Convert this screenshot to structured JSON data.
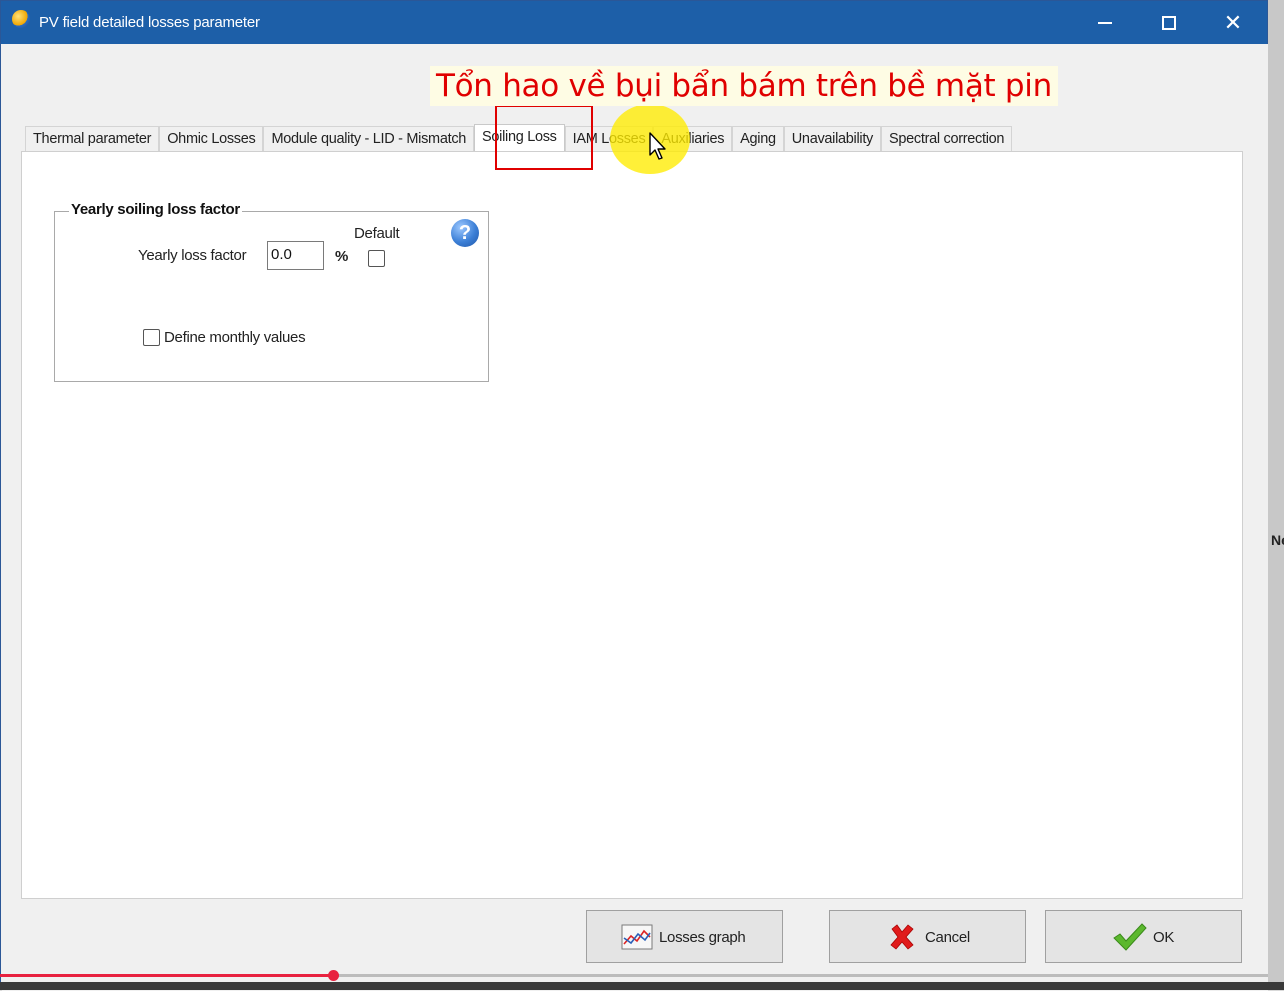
{
  "window": {
    "title": "PV field detailed losses parameter",
    "app_icon": "pvsyst-sun-icon",
    "controls": {
      "minimize": "minimize-icon",
      "maximize": "maximize-icon",
      "close_glyph": "✕"
    }
  },
  "annotation": {
    "text": "Tổn hao về bụi bẩn bám trên bề mặt pin",
    "color": "#e00000"
  },
  "tabs": [
    {
      "label": "Thermal parameter"
    },
    {
      "label": "Ohmic Losses"
    },
    {
      "label": "Module quality - LID - Mismatch"
    },
    {
      "label": "Soiling Loss",
      "active": true
    },
    {
      "label": "IAM Losses"
    },
    {
      "label": "Auxiliaries"
    },
    {
      "label": "Aging"
    },
    {
      "label": "Unavailability"
    },
    {
      "label": "Spectral correction"
    }
  ],
  "soiling": {
    "group_title": "Yearly soiling loss factor",
    "yearly_label": "Yearly loss factor",
    "yearly_value": "0.0",
    "unit": "%",
    "default_label": "Default",
    "default_checked": false,
    "monthly_label": "Define monthly values",
    "monthly_checked": false,
    "help_glyph": "?"
  },
  "buttons": {
    "losses_graph": "Losses graph",
    "cancel": "Cancel",
    "ok": "OK"
  },
  "video_progress": {
    "fraction": 0.263,
    "color": "#e8213f"
  },
  "background_edge_text": "Ne",
  "colors": {
    "titlebar": "#1d5fa8",
    "highlight": "#e00000",
    "cursor_halo": "#ffec00"
  }
}
